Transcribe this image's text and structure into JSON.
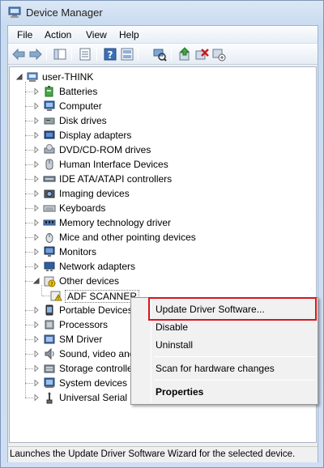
{
  "window": {
    "title": "Device Manager",
    "app_icon": "device-manager-icon"
  },
  "menubar": {
    "items": [
      "File",
      "Action",
      "View",
      "Help"
    ]
  },
  "toolbar": {
    "buttons": [
      "back-arrow-icon",
      "forward-arrow-icon",
      "show-hide-console-tree-icon",
      "properties-icon",
      "help-icon",
      "device-panel-icon",
      "scan-hardware-icon",
      "update-driver-icon",
      "uninstall-icon",
      "disable-device-icon"
    ]
  },
  "tree": {
    "root": "user-THINK",
    "categories": [
      {
        "label": "Batteries",
        "icon": "battery-icon"
      },
      {
        "label": "Computer",
        "icon": "computer-icon"
      },
      {
        "label": "Disk drives",
        "icon": "disk-drive-icon"
      },
      {
        "label": "Display adapters",
        "icon": "display-adapter-icon"
      },
      {
        "label": "DVD/CD-ROM drives",
        "icon": "dvd-drive-icon"
      },
      {
        "label": "Human Interface Devices",
        "icon": "hid-icon"
      },
      {
        "label": "IDE ATA/ATAPI controllers",
        "icon": "ide-controller-icon"
      },
      {
        "label": "Imaging devices",
        "icon": "camera-icon"
      },
      {
        "label": "Keyboards",
        "icon": "keyboard-icon"
      },
      {
        "label": "Memory technology driver",
        "icon": "memory-icon"
      },
      {
        "label": "Mice and other pointing devices",
        "icon": "mouse-icon"
      },
      {
        "label": "Monitors",
        "icon": "monitor-icon"
      },
      {
        "label": "Network adapters",
        "icon": "network-adapter-icon"
      },
      {
        "label": "Other devices",
        "icon": "unknown-device-icon",
        "expanded": true,
        "children": [
          {
            "label": "ADF SCANNER",
            "icon": "warning-device-icon"
          }
        ]
      },
      {
        "label": "Portable Devices",
        "icon": "portable-device-icon"
      },
      {
        "label": "Processors",
        "icon": "processor-icon"
      },
      {
        "label": "SM Driver",
        "icon": "sm-driver-icon"
      },
      {
        "label": "Sound, video and game controllers",
        "icon": "sound-icon"
      },
      {
        "label": "Storage controllers",
        "icon": "storage-controller-icon"
      },
      {
        "label": "System devices",
        "icon": "system-device-icon"
      },
      {
        "label": "Universal Serial Bus controllers",
        "icon": "usb-icon"
      }
    ]
  },
  "context_menu": {
    "items": [
      {
        "label": "Update Driver Software...",
        "highlighted": true
      },
      {
        "label": "Disable"
      },
      {
        "label": "Uninstall"
      },
      {
        "separator": true
      },
      {
        "label": "Scan for hardware changes"
      },
      {
        "separator": true
      },
      {
        "label": "Properties",
        "bold": true
      }
    ],
    "highlight_color": "#d8161e"
  },
  "statusbar": {
    "text": "Launches the Update Driver Software Wizard for the selected device."
  }
}
